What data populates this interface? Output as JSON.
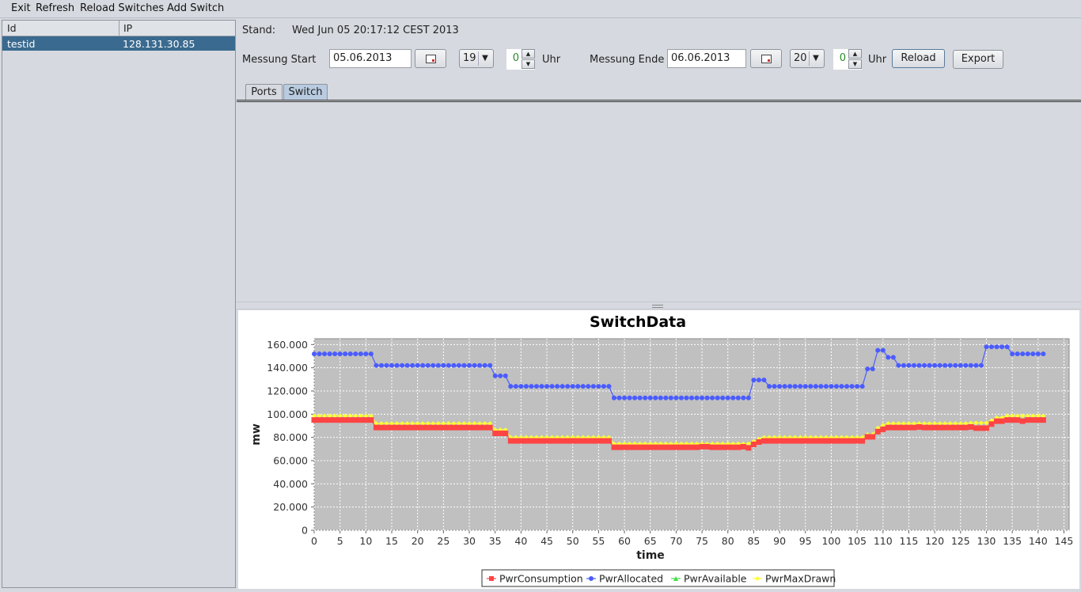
{
  "menu": {
    "exit": "Exit",
    "refresh": "Refresh",
    "reload_switches": "Reload Switches",
    "add_switch": "Add Switch"
  },
  "table": {
    "headers": {
      "id": "Id",
      "ip": "IP"
    },
    "rows": [
      {
        "id": "testid",
        "ip": "128.131.30.85"
      }
    ]
  },
  "status": {
    "label": "Stand:",
    "value": "Wed Jun 05 20:17:12 CEST 2013"
  },
  "controls": {
    "start_label": "Messung Start",
    "start_date": "05.06.2013",
    "start_hour": "19",
    "start_minute": "0",
    "start_unit": "Uhr",
    "end_label": "Messung Ende",
    "end_date": "06.06.2013",
    "end_hour": "20",
    "end_minute": "0",
    "end_unit": "Uhr",
    "reload": "Reload",
    "export": "Export"
  },
  "tabs": [
    "Ports",
    "Switch"
  ],
  "selected_tab": "Switch",
  "chart_data": {
    "type": "line",
    "title": "SwitchData",
    "xlabel": "time",
    "ylabel": "mw",
    "xlim": [
      0,
      146
    ],
    "ylim": [
      0,
      165000
    ],
    "xticks": [
      "0",
      "5",
      "10",
      "15",
      "20",
      "25",
      "30",
      "35",
      "40",
      "45",
      "50",
      "55",
      "60",
      "65",
      "70",
      "75",
      "80",
      "85",
      "90",
      "95",
      "100",
      "105",
      "110",
      "115",
      "120",
      "125",
      "130",
      "135",
      "140",
      "145"
    ],
    "yticks": [
      "0",
      "20.000",
      "40.000",
      "60.000",
      "80.000",
      "100.000",
      "120.000",
      "140.000",
      "160.000"
    ],
    "grid": true,
    "legend_position": "bottom",
    "colors": {
      "PwrConsumption": "#ff4444",
      "PwrAllocated": "#4a5cff",
      "PwrAvailable": "#44dd44",
      "PwrMaxDrawn": "#ffff33",
      "plot_bg": "#c0c0c0"
    },
    "series": [
      {
        "name": "PwrConsumption",
        "marker": "square",
        "segments": [
          [
            0,
            11,
            95000
          ],
          [
            12,
            34,
            88500
          ],
          [
            35,
            37,
            83500
          ],
          [
            38,
            57,
            77000
          ],
          [
            58,
            74,
            71500
          ],
          [
            75,
            76,
            72000
          ],
          [
            77,
            82,
            71500
          ],
          [
            83,
            83,
            72000
          ],
          [
            84,
            84,
            71000
          ],
          [
            85,
            85,
            74000
          ],
          [
            86,
            86,
            76000
          ],
          [
            87,
            106,
            77000
          ],
          [
            107,
            108,
            80500
          ],
          [
            109,
            109,
            85000
          ],
          [
            110,
            110,
            87000
          ],
          [
            111,
            116,
            88500
          ],
          [
            117,
            117,
            89000
          ],
          [
            118,
            126,
            88500
          ],
          [
            127,
            127,
            89000
          ],
          [
            128,
            130,
            88000
          ],
          [
            131,
            131,
            91500
          ],
          [
            132,
            133,
            94000
          ],
          [
            134,
            136,
            95000
          ],
          [
            137,
            137,
            94000
          ],
          [
            138,
            141,
            95000
          ]
        ]
      },
      {
        "name": "PwrAllocated",
        "marker": "circle",
        "segments": [
          [
            0,
            11,
            152000
          ],
          [
            12,
            34,
            142000
          ],
          [
            35,
            37,
            133000
          ],
          [
            38,
            57,
            124000
          ],
          [
            58,
            84,
            114000
          ],
          [
            85,
            87,
            129500
          ],
          [
            88,
            106,
            124000
          ],
          [
            107,
            108,
            139000
          ],
          [
            109,
            110,
            155000
          ],
          [
            111,
            112,
            149000
          ],
          [
            113,
            129,
            142000
          ],
          [
            130,
            134,
            158000
          ],
          [
            135,
            141,
            152000
          ]
        ]
      },
      {
        "name": "PwrAvailable",
        "marker": "triangle",
        "segments": []
      },
      {
        "name": "PwrMaxDrawn",
        "marker": "diamond",
        "segments": [
          [
            0,
            11,
            98500
          ],
          [
            12,
            34,
            92000
          ],
          [
            35,
            37,
            86500
          ],
          [
            38,
            57,
            80000
          ],
          [
            58,
            84,
            74500
          ],
          [
            85,
            85,
            76500
          ],
          [
            86,
            86,
            78500
          ],
          [
            87,
            106,
            80000
          ],
          [
            107,
            108,
            82500
          ],
          [
            109,
            109,
            88000
          ],
          [
            110,
            110,
            90500
          ],
          [
            111,
            126,
            92000
          ],
          [
            127,
            130,
            92500
          ],
          [
            131,
            131,
            94500
          ],
          [
            132,
            133,
            97000
          ],
          [
            134,
            141,
            98500
          ]
        ]
      }
    ]
  }
}
